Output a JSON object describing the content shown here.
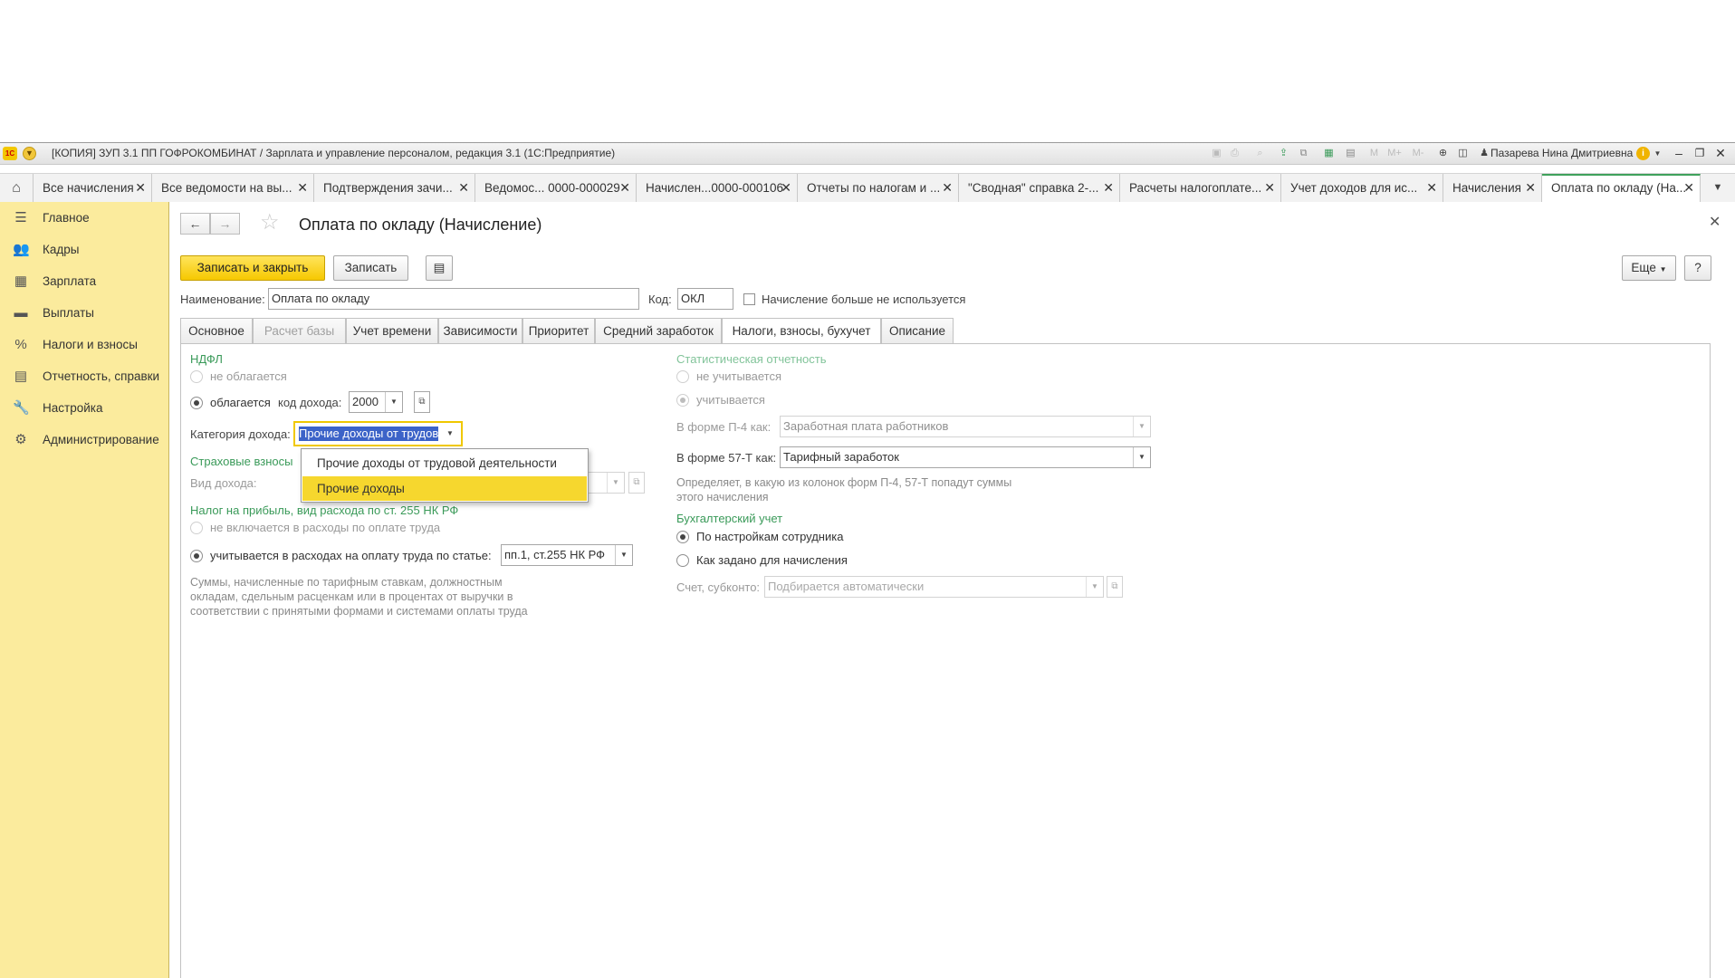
{
  "window": {
    "logo_text": "1С",
    "title": "[КОПИЯ] ЗУП 3.1 ПП ГОФРОКОМБИНАТ / Зарплата и управление персоналом, редакция 3.1  (1С:Предприятие)",
    "toolbar_icons": [
      "save-icon",
      "print-icon",
      "preview-icon",
      "upload-icon",
      "copy-icon",
      "calculator-icon",
      "calendar-icon"
    ],
    "memory_labels": [
      "M",
      "M+",
      "M-"
    ],
    "user": "Пазарева Нина Дмитриевна",
    "info": "i"
  },
  "open_tabs": [
    {
      "label": "Все начисления"
    },
    {
      "label": "Все ведомости на вы..."
    },
    {
      "label": "Подтверждения зачи..."
    },
    {
      "label": "Ведомос... 0000-000029"
    },
    {
      "label": "Начислен...0000-000106"
    },
    {
      "label": "Отчеты по налогам и ..."
    },
    {
      "label": "\"Сводная\" справка 2-..."
    },
    {
      "label": "Расчеты налогоплате..."
    },
    {
      "label": "Учет доходов для ис..."
    },
    {
      "label": "Начисления"
    },
    {
      "label": "Оплата по окладу (На..."
    }
  ],
  "sidebar": {
    "items": [
      {
        "label": "Главное",
        "icon": "menu-icon"
      },
      {
        "label": "Кадры",
        "icon": "people-icon"
      },
      {
        "label": "Зарплата",
        "icon": "calculator-icon"
      },
      {
        "label": "Выплаты",
        "icon": "wallet-icon"
      },
      {
        "label": "Налоги и взносы",
        "icon": "percent-icon"
      },
      {
        "label": "Отчетность, справки",
        "icon": "reports-icon"
      },
      {
        "label": "Настройка",
        "icon": "wrench-icon"
      },
      {
        "label": "Администрирование",
        "icon": "gear-icon"
      }
    ]
  },
  "form": {
    "title": "Оплата по окладу (Начисление)",
    "buttons": {
      "save_close": "Записать и закрыть",
      "save": "Записать",
      "more": "Еще",
      "help": "?"
    },
    "name_label": "Наименование:",
    "name_value": "Оплата по окладу",
    "code_label": "Код:",
    "code_value": "ОКЛ",
    "unused_label": "Начисление больше не используется",
    "unused_checked": false,
    "tabs": [
      {
        "label": "Основное",
        "disabled": false
      },
      {
        "label": "Расчет базы",
        "disabled": true
      },
      {
        "label": "Учет времени",
        "disabled": false
      },
      {
        "label": "Зависимости",
        "disabled": false
      },
      {
        "label": "Приоритет",
        "disabled": false
      },
      {
        "label": "Средний заработок",
        "disabled": false
      },
      {
        "label": "Налоги, взносы, бухучет",
        "disabled": false,
        "active": true
      },
      {
        "label": "Описание",
        "disabled": false
      }
    ]
  },
  "ndfl": {
    "title": "НДФЛ",
    "not_taxed": "не облагается",
    "taxed": "облагается",
    "income_code_label": "код дохода:",
    "income_code": "2000",
    "category_label": "Категория дохода:",
    "category_value": "Прочие доходы от трудов",
    "category_options": [
      "Прочие доходы от трудовой деятельности",
      "Прочие доходы"
    ],
    "highlighted_option": "Прочие доходы"
  },
  "insurance": {
    "title": "Страховые взносы",
    "income_type_label": "Вид дохода:"
  },
  "profit_tax": {
    "title": "Налог на прибыль, вид расхода по ст. 255 НК РФ",
    "not_included": "не включается в расходы по оплате труда",
    "included": "учитывается в расходах на оплату труда по статье:",
    "article": "пп.1, ст.255 НК РФ",
    "note_lines": [
      "Суммы, начисленные по тарифным ставкам, должностным",
      "окладам, сдельным расценкам или в процентах от выручки в",
      "соответствии с принятыми формами и системами оплаты труда"
    ]
  },
  "statistics": {
    "title": "Статистическая отчетность",
    "not_counted": "не учитывается",
    "counted": "учитывается",
    "p4_label": "В форме П-4 как:",
    "p4_value": "Заработная плата работников",
    "f57_label": "В форме 57-Т как:",
    "f57_value": "Тарифный заработок",
    "note_lines": [
      "Определяет, в какую из колонок форм П-4, 57-Т попадут суммы",
      "этого начисления"
    ]
  },
  "accounting": {
    "title": "Бухгалтерский учет",
    "by_employee": "По настройкам сотрудника",
    "as_set": "Как задано для начисления",
    "account_label": "Счет, субконто:",
    "account_placeholder": "Подбирается автоматически"
  },
  "colors": {
    "accent_yellow": "#f6c800",
    "sidebar_bg": "#fbeb9d",
    "section_green": "#3a9a59",
    "selection_blue": "#3c63c8",
    "active_tab_border": "#3fa15b"
  }
}
